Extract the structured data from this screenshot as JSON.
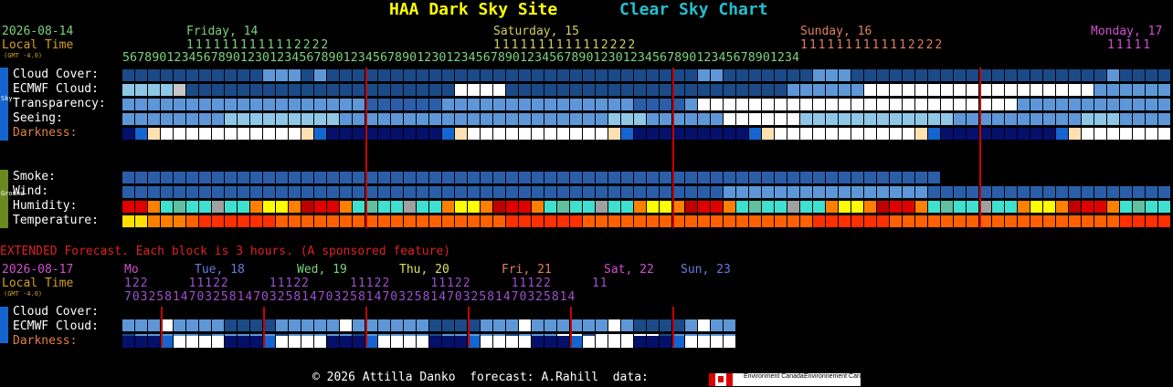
{
  "header": {
    "site": "HAA Dark Sky Site",
    "chart": "Clear Sky Chart"
  },
  "top": {
    "date": "2026-08-14",
    "local_time": "Local Time",
    "gmt": "(GMT -4.0)",
    "days": [
      "Friday, 14",
      "Saturday, 15",
      "Sunday, 16",
      "Monday, 17"
    ],
    "tens_1": "1111111111112222",
    "tens_2": "1111111111112222",
    "tens_3": "1111111111112222",
    "tens_4": "11111",
    "hours": "56789012345678901230123456789012345678901230123456789012345678901230123456789012345678901234",
    "labels": {
      "cloud": "Cloud Cover:",
      "ecmwf": "ECMWF Cloud:",
      "trans": "Transparency:",
      "seeing": "Seeing:",
      "dark": "Darkness:",
      "smoke": "Smoke:",
      "wind": "Wind:",
      "humidity": "Humidity:",
      "temp": "Temperature:"
    },
    "tabs": {
      "sky": "Sky",
      "ground": "Ground"
    }
  },
  "extended": {
    "note": "EXTENDED Forecast. Each block is 3 hours. (A sponsored feature)",
    "date": "2026-08-17",
    "local_time": "Local Time",
    "gmt": "(GMT -4.0)",
    "days": [
      "Mo",
      "Tue, 18",
      "Wed, 19",
      "Thu, 20",
      "Fri, 21",
      "Sat, 22",
      "Sun, 23"
    ],
    "row1": "122     11122     11122     11122     11122     11122     11",
    "row2": "70325814703258147032581470325814703258147032581470325814"
  },
  "footer": {
    "credit": "© 2026 Attilla Danko  forecast: A.Rahill  data:",
    "ec1": "Environment Canada",
    "ec2": "Environnement Canada"
  },
  "colors": {
    "cloud": [
      "#1b4a88",
      "#1b4a88",
      "#1b4a88",
      "#1b4a88",
      "#1b4a88",
      "#1b4a88",
      "#1b4a88",
      "#1b4a88",
      "#1b4a88",
      "#1b4a88",
      "#1b4a88",
      "#5e97d8",
      "#5e97d8",
      "#5e97d8",
      "#1b4a88",
      "#5e97d8",
      "#1b4a88",
      "#1b4a88",
      "#1b4a88",
      "#1b4a88",
      "#1b4a88",
      "#1b4a88",
      "#1b4a88",
      "#1b4a88",
      "#1b4a88",
      "#1b4a88",
      "#1b4a88",
      "#1b4a88",
      "#1b4a88",
      "#1b4a88",
      "#1b4a88",
      "#1b4a88",
      "#1b4a88",
      "#1b4a88",
      "#1b4a88",
      "#1b4a88",
      "#1b4a88",
      "#1b4a88",
      "#1b4a88",
      "#1b4a88",
      "#1b4a88",
      "#1b4a88",
      "#1b4a88",
      "#1b4a88",
      "#1b4a88",
      "#5e97d8",
      "#5e97d8",
      "#1b4a88",
      "#1b4a88",
      "#1b4a88",
      "#1b4a88",
      "#1b4a88",
      "#1b4a88",
      "#1b4a88",
      "#5e97d8",
      "#5e97d8",
      "#5e97d8",
      "#1b4a88",
      "#1b4a88",
      "#1b4a88",
      "#1b4a88",
      "#1b4a88",
      "#1b4a88",
      "#1b4a88",
      "#1b4a88",
      "#1b4a88",
      "#1b4a88",
      "#1b4a88",
      "#1b4a88",
      "#1b4a88",
      "#1b4a88",
      "#1b4a88",
      "#1b4a88",
      "#1b4a88",
      "#1b4a88",
      "#1b4a88",
      "#1b4a88",
      "#5e97d8",
      "#1b4a88",
      "#1b4a88",
      "#1b4a88",
      "#1b4a88",
      "#1b4a88",
      "#1b4a88",
      "#5e97d8",
      "#8ec8e6",
      "#ffffff",
      "#ffffff",
      "#ffffff",
      "#ffffff",
      "#ffffff",
      "#ffffff",
      "#ffffff",
      "#ffffff",
      "#ffffff",
      "#ffffff",
      "#ffffff",
      "#ffffff",
      "#ffffff",
      "#ffffff"
    ]
  }
}
